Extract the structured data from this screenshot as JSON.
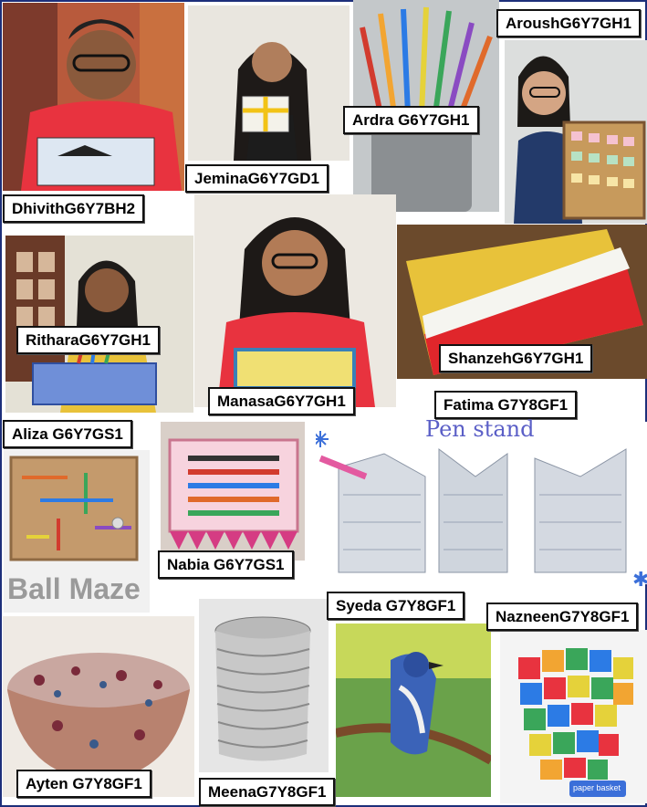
{
  "labels": {
    "dhivith": "DhivithG6Y7BH2",
    "jemina": "JeminaG6Y7GD1",
    "ardra": "Ardra G6Y7GH1",
    "aroush": "AroushG6Y7GH1",
    "rithara": "RitharaG6Y7GH1",
    "manasa": "ManasaG6Y7GH1",
    "shanzeh": "ShanzehG6Y7GH1",
    "fatima": "Fatima G7Y8GF1",
    "aliza": "Aliza G6Y7GS1",
    "nabia": "Nabia G6Y7GS1",
    "syeda": "Syeda G7Y8GF1",
    "nazneen": "NazneenG7Y8GF1",
    "ayten": "Ayten G7Y8GF1",
    "meena": "MeenaG7Y8GF1"
  },
  "captions": {
    "ball_maze": "Ball Maze",
    "pen_stand": "Pen stand",
    "paper_basket": "paper basket"
  },
  "colors": {
    "frame": "#1d2f7a",
    "label_border": "#111111",
    "tshirt_red": "#e8333f",
    "pen_stand_ink": "#5b5fc7"
  }
}
